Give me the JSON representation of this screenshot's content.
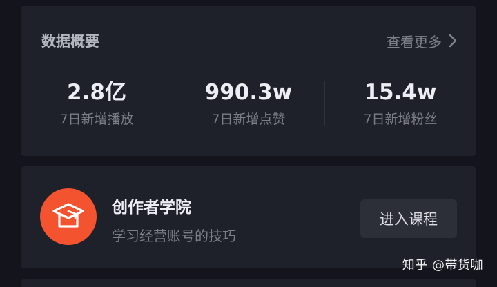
{
  "overview": {
    "title": "数据概要",
    "view_more": "查看更多",
    "stats": [
      {
        "value": "2.8亿",
        "label": "7日新增播放"
      },
      {
        "value": "990.3w",
        "label": "7日新增点赞"
      },
      {
        "value": "15.4w",
        "label": "7日新增粉丝"
      }
    ]
  },
  "academy": {
    "icon": "graduation-cap-icon",
    "icon_color": "#f3532e",
    "title": "创作者学院",
    "subtitle": "学习经营账号的技巧",
    "button_label": "进入课程"
  },
  "watermark": "知乎 @带货咖"
}
